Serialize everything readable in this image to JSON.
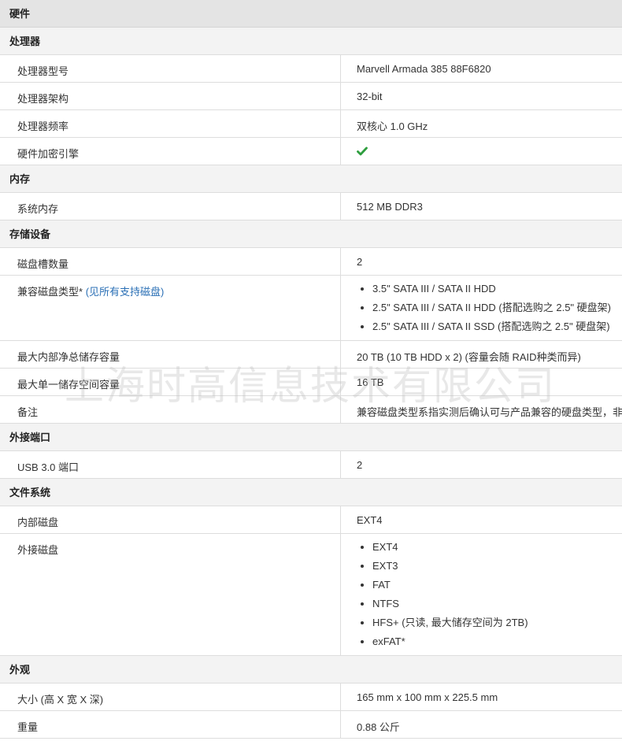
{
  "header": {
    "title": "硬件"
  },
  "sections": [
    {
      "title": "处理器",
      "rows": [
        {
          "label": "处理器型号",
          "value": "Marvell Armada 385 88F6820"
        },
        {
          "label": "处理器架构",
          "value": "32-bit"
        },
        {
          "label": "处理器频率",
          "value": "双核心 1.0 GHz"
        },
        {
          "label": "硬件加密引擎",
          "icon": "check-icon",
          "icon_color": "#2e9e3e"
        }
      ]
    },
    {
      "title": "内存",
      "rows": [
        {
          "label": "系统内存",
          "value": "512 MB DDR3"
        }
      ]
    },
    {
      "title": "存储设备",
      "rows": [
        {
          "label": "磁盘槽数量",
          "value": "2"
        },
        {
          "label": "兼容磁盘类型*",
          "label_link": "(见所有支持磁盘)",
          "list": [
            "3.5\" SATA III / SATA II HDD",
            "2.5\" SATA III / SATA II HDD (搭配选购之 2.5\" 硬盘架)",
            "2.5\" SATA III / SATA II SSD (搭配选购之 2.5\" 硬盘架)"
          ]
        },
        {
          "label": "最大内部净总储存容量",
          "value": "20 TB (10 TB HDD x 2) (容量会随 RAID种类而异)"
        },
        {
          "label": "最大单一储存空间容量",
          "value": "16 TB"
        },
        {
          "label": "备注",
          "value": "兼容磁盘类型系指实测后确认可与产品兼容的硬盘类型，非"
        }
      ]
    },
    {
      "title": "外接端口",
      "rows": [
        {
          "label": "USB 3.0 端口",
          "value": "2"
        }
      ]
    },
    {
      "title": "文件系统",
      "rows": [
        {
          "label": "内部磁盘",
          "value": "EXT4"
        },
        {
          "label": "外接磁盘",
          "list": [
            "EXT4",
            "EXT3",
            "FAT",
            "NTFS",
            "HFS+ (只读, 最大储存空间为 2TB)",
            "exFAT*"
          ]
        }
      ]
    },
    {
      "title": "外观",
      "rows": [
        {
          "label": "大小 (高 X 宽 X 深)",
          "value": "165 mm x 100 mm x 225.5 mm"
        },
        {
          "label": "重量",
          "value": "0.88 公斤"
        }
      ]
    }
  ],
  "watermark": "上海时高信息技术有限公司",
  "colors": {
    "link": "#2a6fb5",
    "check": "#2e9e3e",
    "header_bg": "#e4e4e4",
    "section_bg": "#f3f3f3"
  }
}
